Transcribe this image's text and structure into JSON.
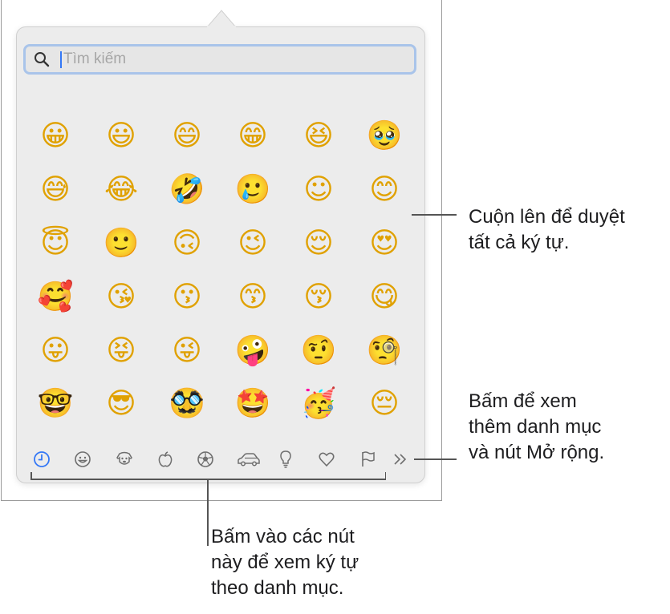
{
  "search": {
    "placeholder": "Tìm kiếm"
  },
  "emoji_grid": [
    "😀",
    "😃",
    "😄",
    "😁",
    "😆",
    "🥹",
    "😅",
    "😂",
    "🤣",
    "🥲",
    "☺",
    "😊",
    "😇",
    "🙂",
    "🙃",
    "😉",
    "😌",
    "😍",
    "🥰",
    "😘",
    "😗",
    "😙",
    "😚",
    "😋",
    "😛",
    "😝",
    "😜",
    "🤪",
    "🤨",
    "🧐",
    "🤓",
    "😎",
    "🥸",
    "🤩",
    "🥳",
    "😔"
  ],
  "categories": [
    {
      "name": "recent",
      "icon": "clock-icon",
      "selected": true
    },
    {
      "name": "smileys-people",
      "icon": "smiley-icon"
    },
    {
      "name": "animals-nature",
      "icon": "dog-icon"
    },
    {
      "name": "food-drink",
      "icon": "apple-icon"
    },
    {
      "name": "activity",
      "icon": "soccer-ball-icon"
    },
    {
      "name": "travel-places",
      "icon": "car-icon"
    },
    {
      "name": "objects",
      "icon": "lightbulb-icon"
    },
    {
      "name": "symbols",
      "icon": "heart-icon"
    },
    {
      "name": "flags",
      "icon": "flag-icon"
    },
    {
      "name": "more",
      "icon": "double-chevron-right-icon"
    }
  ],
  "colors": {
    "accent": "#3478f6",
    "search_focus_ring": "#a9c4ea",
    "panel_background": "#ececec",
    "icon_gray": "#6e6e6e",
    "callout_line": "#555555"
  },
  "annotations": {
    "scroll": "Cuộn lên để duyệt\ntất cả ký tự.",
    "more": "Bấm để xem\nthêm danh mục\nvà nút Mở rộng.",
    "categories": "Bấm vào các nút\nnày để xem ký tự\ntheo danh mục."
  }
}
